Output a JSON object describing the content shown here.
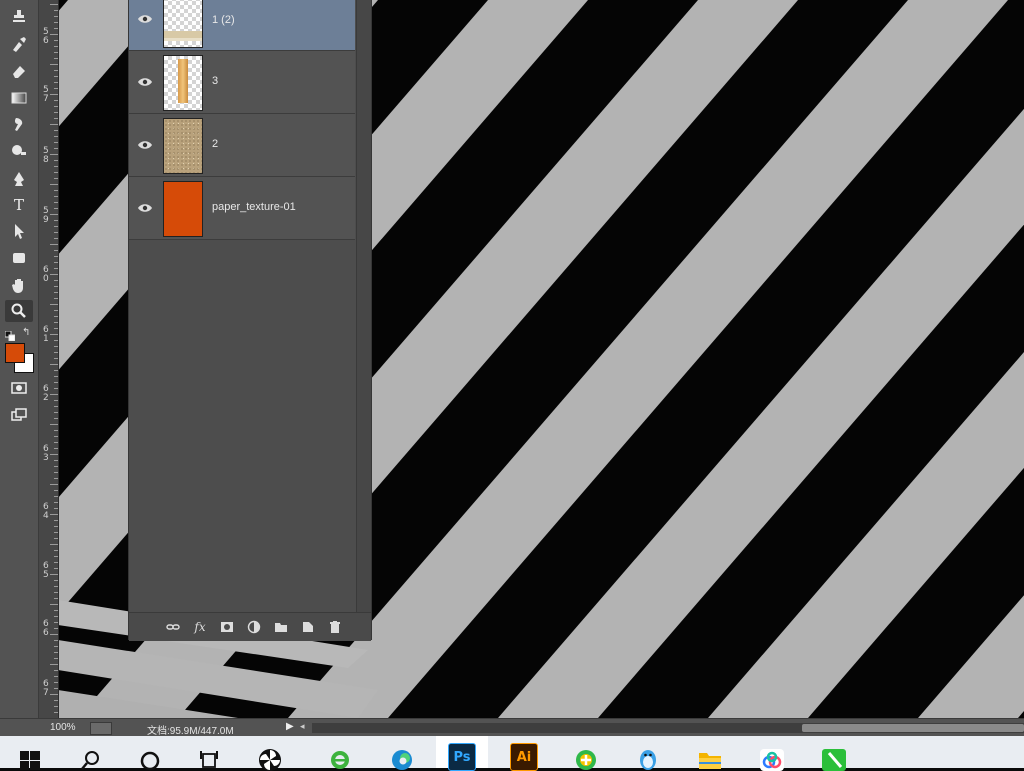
{
  "app": {
    "name": "Adobe Photoshop"
  },
  "toolbar": {
    "tools": [
      {
        "name": "clone-stamp-tool-icon"
      },
      {
        "name": "history-brush-tool-icon"
      },
      {
        "name": "eraser-tool-icon"
      },
      {
        "name": "gradient-tool-icon"
      },
      {
        "name": "blur-tool-icon"
      },
      {
        "name": "dodge-tool-icon"
      },
      {
        "name": "pen-tool-icon"
      },
      {
        "name": "type-tool-icon"
      },
      {
        "name": "path-selection-tool-icon"
      },
      {
        "name": "rectangle-tool-icon"
      },
      {
        "name": "hand-tool-icon"
      },
      {
        "name": "zoom-tool-icon"
      },
      {
        "name": "quick-mask-icon"
      },
      {
        "name": "screen-mode-icon"
      }
    ],
    "type_tool_glyph": "T",
    "foreground_color": "#d64b08",
    "background_color": "#ffffff"
  },
  "ruler": {
    "labels": [
      "5\n6",
      "5\n7",
      "5\n8",
      "5\n9",
      "6\n0",
      "6\n1",
      "6\n2",
      "6\n3",
      "6\n4",
      "6\n5",
      "6\n6",
      "6\n7"
    ]
  },
  "layers": {
    "items": [
      {
        "name": "1 (2)",
        "visible": true,
        "selected": true,
        "thumb": "transparent-with-paper-strip"
      },
      {
        "name": "3",
        "visible": true,
        "selected": false,
        "thumb": "transparent-with-tan-strip"
      },
      {
        "name": "2",
        "visible": true,
        "selected": false,
        "thumb": "sand-texture"
      },
      {
        "name": "paper_texture-01",
        "visible": true,
        "selected": false,
        "thumb": "solid-orange"
      }
    ],
    "footer_buttons": [
      {
        "name": "link-layers-icon",
        "glyph": "⛓"
      },
      {
        "name": "layer-style-icon",
        "glyph": "fx"
      },
      {
        "name": "layer-mask-icon",
        "glyph": "◘"
      },
      {
        "name": "adjustment-layer-icon",
        "glyph": "◐"
      },
      {
        "name": "new-group-icon",
        "glyph": "▬"
      },
      {
        "name": "new-layer-icon",
        "glyph": "❐"
      },
      {
        "name": "delete-layer-icon",
        "glyph": "🗑"
      }
    ]
  },
  "status": {
    "zoom": "100%",
    "doc_size": "文档:95.9M/447.0M"
  },
  "taskbar": {
    "items": [
      {
        "name": "start-button",
        "icon": "windows-logo-icon"
      },
      {
        "name": "search-button",
        "icon": "search-icon"
      },
      {
        "name": "cortana-button",
        "icon": "cortana-ring-icon"
      },
      {
        "name": "task-view-button",
        "icon": "task-view-icon"
      },
      {
        "name": "pinwheel-app",
        "icon": "pinwheel-icon"
      },
      {
        "name": "ie-browser",
        "icon": "ie-browser-icon"
      },
      {
        "name": "edge-browser",
        "icon": "edge-browser-icon"
      },
      {
        "name": "photoshop-app",
        "icon": "photoshop-icon",
        "label": "Ps",
        "active": true
      },
      {
        "name": "illustrator-app",
        "icon": "illustrator-icon",
        "label": "Ai"
      },
      {
        "name": "360-browser",
        "icon": "360-icon"
      },
      {
        "name": "qq-app",
        "icon": "qq-penguin-icon"
      },
      {
        "name": "file-explorer",
        "icon": "folder-icon"
      },
      {
        "name": "baidu-netdisk",
        "icon": "cloud-icon"
      },
      {
        "name": "green-app",
        "icon": "green-pen-icon"
      }
    ]
  }
}
